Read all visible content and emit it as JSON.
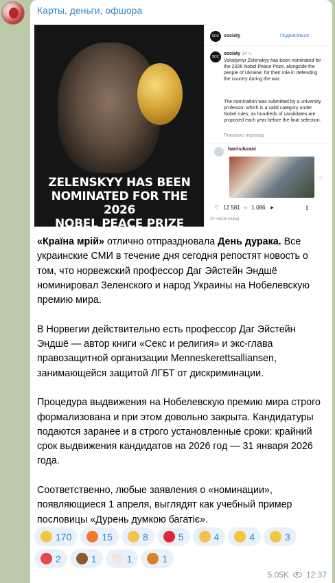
{
  "channel": {
    "name": "Карты, деньги, офшора"
  },
  "post_image": {
    "headline_lines": [
      "ZELENSKYY HAS BEEN",
      "NOMINATED FOR THE 2026",
      "NOBEL PEACE PRIZE"
    ],
    "instagram": {
      "account": "sociaty",
      "follow_label": "Подписаться",
      "post_user": "sociaty",
      "post_age": "14 ч.",
      "caption_1": "Volodymyr Zelenskyy has been nominated for the 2026 Nobel Peace Prize, alongside the people of Ukraine, for their role in defending the country during the war.",
      "caption_2": "The nomination was submitted by a university professor, which is a valid category under Nobel rules, as hundreds of candidates are proposed each year before the final selection.",
      "translate_label": "Показать перевод",
      "comment_user": "harrisdurani",
      "likes": "12 581",
      "comments": "1 086",
      "time": "14 часов назад"
    }
  },
  "text": {
    "p1_bold_a": "«Країна мрій»",
    "p1_mid": " отлично отпраздновала ",
    "p1_bold_b": "День дурака.",
    "p1_rest": " Все украинские СМИ в течение дня сегодня репостят новость о том, что норвежский профессор Даг Эйстейн Эндшё номинировал Зеленского и народ Украины на Нобелевскую премию мира.",
    "p2": "В Норвегии действительно есть профессор Даг Эйстейн Эндшё — автор книги «Секс и религия» и экс-глава правозащитной организации Menneskerettsalliansen, занимающейся защитой ЛГБТ от дискриминации.",
    "p3": "Процедура выдвижения на Нобелевскую премию мира строго формализована и при этом довольно закрыта. Кандидатуры подаются заранее и в строго установленные сроки: крайний срок выдвижения кандидатов на 2026 год — 31 января 2026 года.",
    "p4": "Соответственно, любые заявления о «номинации», появляющиеся 1 апреля, выглядят как учебный пример пословицы «Дурень думкою багатіє»."
  },
  "reactions": [
    {
      "icon": "rofl-icon",
      "count": "170",
      "color": "#f5c542"
    },
    {
      "icon": "fire-icon",
      "count": "15",
      "color": "#f5772b"
    },
    {
      "icon": "thumbs-up-icon",
      "count": "8",
      "color": "#f2c14e"
    },
    {
      "icon": "heart-icon",
      "count": "5",
      "color": "#e0283a"
    },
    {
      "icon": "clap-icon",
      "count": "4",
      "color": "#f2c14e"
    },
    {
      "icon": "zany-face-icon",
      "count": "4",
      "color": "#f5c542"
    },
    {
      "icon": "woozy-face-icon",
      "count": "3",
      "color": "#f5c542"
    },
    {
      "icon": "pill-icon",
      "count": "2",
      "color": "#e84a4a"
    },
    {
      "icon": "poop-icon",
      "count": "1",
      "color": "#8b5a2b"
    },
    {
      "icon": "clown-icon",
      "count": "1",
      "color": "#f0e8e0"
    },
    {
      "icon": "hotdog-icon",
      "count": "1",
      "color": "#d9822b"
    }
  ],
  "meta": {
    "views": "5.05K",
    "time": "12:37"
  }
}
